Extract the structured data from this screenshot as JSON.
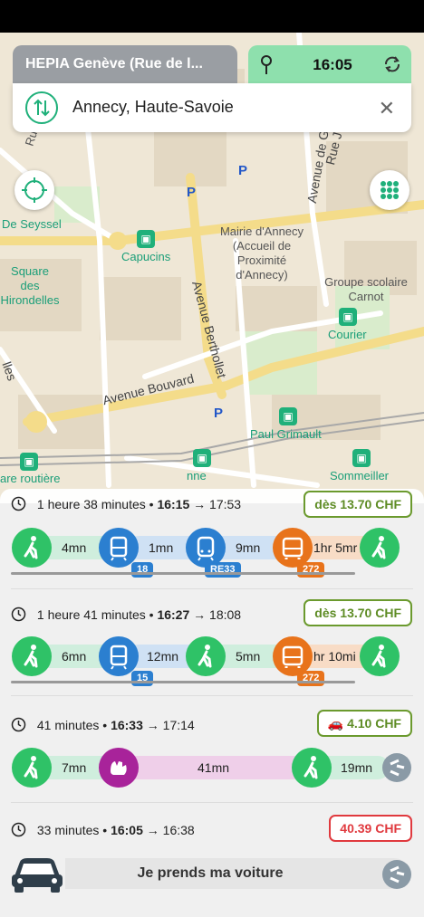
{
  "search": {
    "origin": "HEPIA Genève (Rue de l...",
    "time": "16:05",
    "destination": "Annecy, Haute-Savoie"
  },
  "map_labels": {
    "de_seyssel": "De Seyssel",
    "capucins": "Capucins",
    "square": "Square des Hirondelles",
    "mairie": "Mairie d'Annecy (Accueil de Proximité d'Annecy)",
    "groupe_scolaire": "Groupe scolaire Carnot",
    "courier": "Courier",
    "avenue_berthollet": "Avenue Berthollet",
    "avenue_bouvard": "Avenue Bouvard",
    "paul_grimault": "Paul Grimault",
    "gare_routiere": "are routière",
    "sommeiller": "Sommeiller",
    "rue_f": "Rue F",
    "avenue_g": "Avenue de G",
    "rue_j": "Rue J",
    "lles": "lles",
    "nne": "nne",
    "parking": "P"
  },
  "routes": [
    {
      "meta_duration": "1 heure 38 minutes",
      "meta_depart": "16:15",
      "meta_arrive": "17:53",
      "price": "dès 13.70 CHF",
      "steps": [
        {
          "mode": "walk",
          "duration": "4mn"
        },
        {
          "mode": "tram",
          "duration": "1mn",
          "line": "18"
        },
        {
          "mode": "train",
          "duration": "9mn",
          "line": "RE33"
        },
        {
          "mode": "bus",
          "duration": "1hr 5mr",
          "line": "272"
        },
        {
          "mode": "walk",
          "duration": ""
        }
      ]
    },
    {
      "meta_duration": "1 heure 41 minutes",
      "meta_depart": "16:27",
      "meta_arrive": "18:08",
      "price": "dès 13.70 CHF",
      "steps": [
        {
          "mode": "walk",
          "duration": "6mn"
        },
        {
          "mode": "tram",
          "duration": "12mn",
          "line": "15"
        },
        {
          "mode": "walk",
          "duration": "5mn"
        },
        {
          "mode": "bus",
          "duration": "hr 10mi",
          "line": "272"
        },
        {
          "mode": "walk",
          "duration": ""
        }
      ]
    },
    {
      "meta_duration": "41 minutes",
      "meta_depart": "16:33",
      "meta_arrive": "17:14",
      "price": "4.10 CHF",
      "steps": [
        {
          "mode": "walk",
          "duration": "7mn"
        },
        {
          "mode": "carpool",
          "duration": "41mn"
        },
        {
          "mode": "walk",
          "duration": "19mn"
        }
      ]
    },
    {
      "meta_duration": "33 minutes",
      "meta_depart": "16:05",
      "meta_arrive": "16:38",
      "price": "40.39 CHF",
      "car_label": "Je prends ma voiture"
    }
  ],
  "separator": "•",
  "arrow": "→",
  "colors": {
    "walk": "#2fc267",
    "tram": "#2b7fd0",
    "bus": "#e8731b",
    "carpool": "#a8239a",
    "price_green": "#5e8c25",
    "price_red": "#e0393e",
    "accent": "#1fb07a"
  },
  "icons": [
    "pin-icon",
    "refresh-icon",
    "swap-icon",
    "close-icon",
    "locate-icon",
    "grid-icon",
    "clock-icon",
    "walk-icon",
    "tram-icon",
    "train-icon",
    "bus-icon",
    "carpool-icon",
    "car-icon",
    "share-icon"
  ]
}
